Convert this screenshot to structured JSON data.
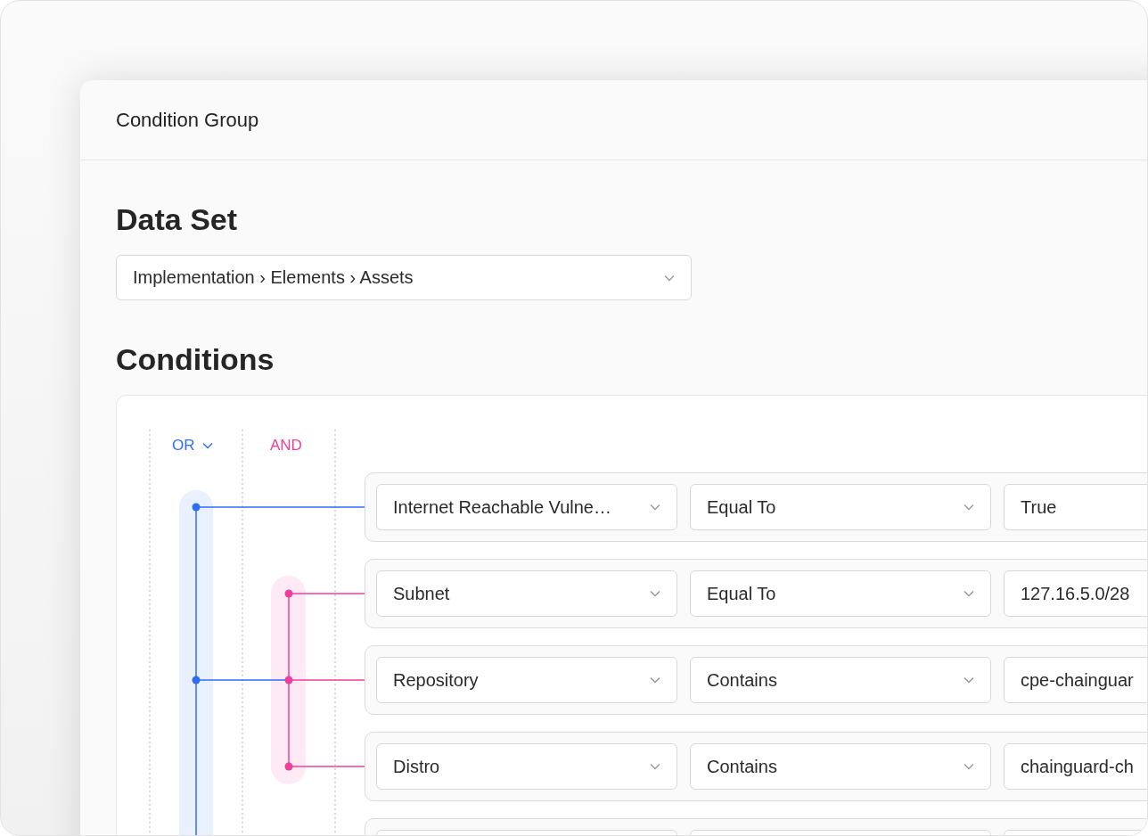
{
  "panel": {
    "title": "Condition Group"
  },
  "data_set": {
    "heading": "Data Set",
    "value": "Implementation › Elements › Assets"
  },
  "conditions": {
    "heading": "Conditions",
    "root": {
      "label": "OR",
      "kind": "dropdown",
      "children": [
        {
          "kind": "condition",
          "field": "Internet Reachable Vulne…",
          "operator": "Equal To",
          "value": "True"
        },
        {
          "kind": "group",
          "label": "AND",
          "children": [
            {
              "kind": "condition",
              "field": "Subnet",
              "operator": "Equal To",
              "value": "127.16.5.0/28"
            },
            {
              "kind": "condition",
              "field": "Repository",
              "operator": "Contains",
              "value": "cpe-chainguar"
            },
            {
              "kind": "condition",
              "field": "Distro",
              "operator": "Contains",
              "value": "chainguard-ch"
            }
          ]
        },
        {
          "kind": "clipped"
        }
      ]
    }
  }
}
